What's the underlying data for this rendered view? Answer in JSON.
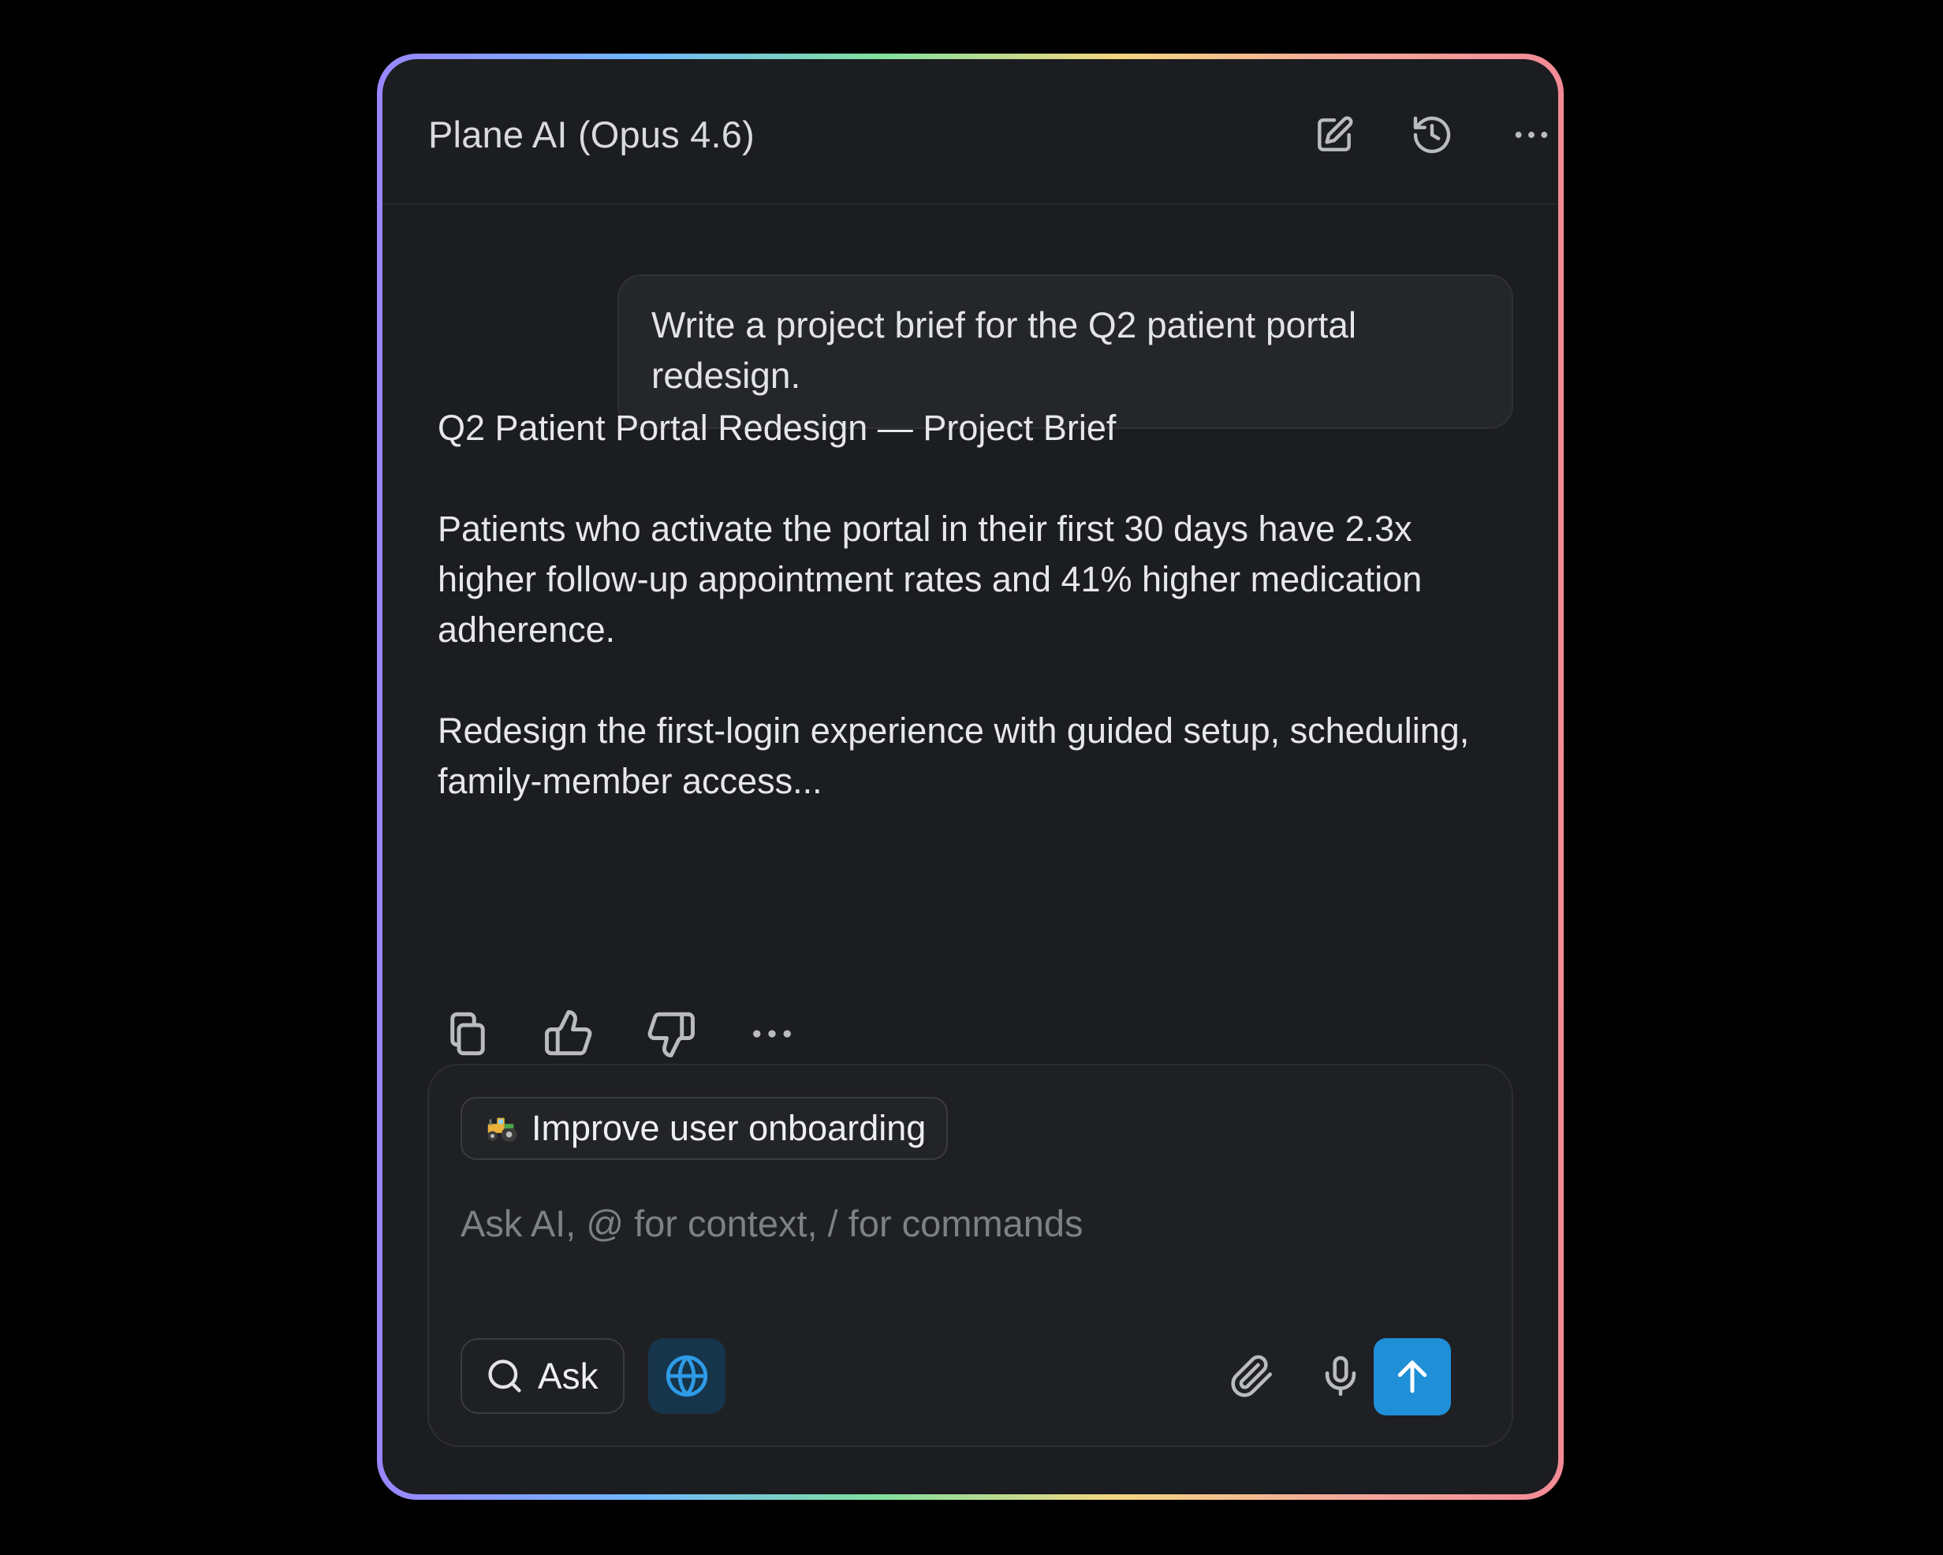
{
  "header": {
    "title": "Plane AI (Opus 4.6)",
    "icons": [
      "edit-icon",
      "history-icon",
      "more-horizontal-icon"
    ]
  },
  "conversation": {
    "user_message": "Write a project brief for the Q2 patient portal redesign.",
    "assistant_message": {
      "title": "Q2 Patient Portal Redesign — Project Brief",
      "paragraph_1": "Patients who activate the portal in their first 30 days have 2.3x higher follow-up appointment rates and 41% higher medication adherence.",
      "paragraph_2": "Redesign the first-login experience with guided setup, scheduling, family-member access..."
    },
    "message_actions": [
      "copy-icon",
      "thumbs-up-icon",
      "thumbs-down-icon",
      "more-horizontal-icon"
    ]
  },
  "composer": {
    "context_chip": {
      "emoji_icon": "tractor-icon",
      "label": "Improve user onboarding"
    },
    "input": {
      "placeholder": "Ask AI, @ for context, / for commands",
      "value": ""
    },
    "mode_button": {
      "icon": "search-icon",
      "label": "Ask"
    },
    "web_search_toggle": {
      "icon": "globe-icon",
      "active": true
    },
    "attach_icon": "paperclip-icon",
    "mic_icon": "microphone-icon",
    "send_icon": "arrow-up-icon"
  },
  "colors": {
    "background": "#000000",
    "panel": "#1c1d20",
    "accent": "#1f8fd8",
    "globe_active_bg": "#16344a",
    "globe_active_icon": "#2e9be6"
  }
}
